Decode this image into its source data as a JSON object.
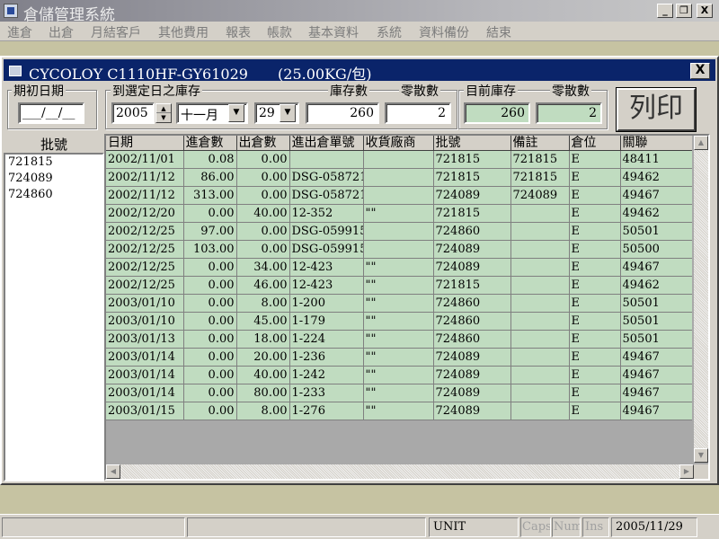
{
  "app": {
    "title": "倉儲管理系統"
  },
  "window_buttons": {
    "minimize": "_",
    "restore": "❐",
    "close": "X"
  },
  "menu": [
    "進倉",
    "出倉",
    "月結客戶",
    "其他費用",
    "報表",
    "帳款",
    "基本資料",
    "系統",
    "資料備份",
    "結束"
  ],
  "child": {
    "title": "CYCOLOY C1110HF-GY61029",
    "weight": "(25.00KG/包)",
    "close": "X"
  },
  "form": {
    "opening_date_label": "期初日期",
    "opening_date_value": "___/__/__",
    "stock_to_date_label": "到選定日之庫存",
    "year": "2005",
    "month": "十一月",
    "day": "29",
    "stock_qty_label": "庫存數",
    "stock_qty_value": "260",
    "loose_qty_label": "零散數",
    "loose_qty_value": "2",
    "current_stock_label": "目前庫存",
    "current_stock_value": "260",
    "current_loose_label": "零散數",
    "current_loose_value": "2",
    "print_label": "列印"
  },
  "batch_list": {
    "header": "批號",
    "items": [
      "721815",
      "724089",
      "724860"
    ]
  },
  "grid": {
    "columns": [
      "日期",
      "進倉數",
      "出倉數",
      "進出倉單號",
      "收貨廠商",
      "批號",
      "備註",
      "倉位",
      "關聯"
    ],
    "rows": [
      [
        "2002/11/01",
        "0.08",
        "0.00",
        "",
        "",
        "721815",
        "721815",
        "E",
        "48411"
      ],
      [
        "2002/11/12",
        "86.00",
        "0.00",
        "DSG-058721",
        "",
        "721815",
        "721815",
        "E",
        "49462"
      ],
      [
        "2002/11/12",
        "313.00",
        "0.00",
        "DSG-058721",
        "",
        "724089",
        "724089",
        "E",
        "49467"
      ],
      [
        "2002/12/20",
        "0.00",
        "40.00",
        "12-352",
        "\"\"",
        "721815",
        "",
        "E",
        "49462"
      ],
      [
        "2002/12/25",
        "97.00",
        "0.00",
        "DSG-059915",
        "",
        "724860",
        "",
        "E",
        "50501"
      ],
      [
        "2002/12/25",
        "103.00",
        "0.00",
        "DSG-059915",
        "",
        "724089",
        "",
        "E",
        "50500"
      ],
      [
        "2002/12/25",
        "0.00",
        "34.00",
        "12-423",
        "\"\"",
        "724089",
        "",
        "E",
        "49467"
      ],
      [
        "2002/12/25",
        "0.00",
        "46.00",
        "12-423",
        "\"\"",
        "721815",
        "",
        "E",
        "49462"
      ],
      [
        "2003/01/10",
        "0.00",
        "8.00",
        "1-200",
        "\"\"",
        "724860",
        "",
        "E",
        "50501"
      ],
      [
        "2003/01/10",
        "0.00",
        "45.00",
        "1-179",
        "\"\"",
        "724860",
        "",
        "E",
        "50501"
      ],
      [
        "2003/01/13",
        "0.00",
        "18.00",
        "1-224",
        "\"\"",
        "724860",
        "",
        "E",
        "50501"
      ],
      [
        "2003/01/14",
        "0.00",
        "20.00",
        "1-236",
        "\"\"",
        "724089",
        "",
        "E",
        "49467"
      ],
      [
        "2003/01/14",
        "0.00",
        "40.00",
        "1-242",
        "\"\"",
        "724089",
        "",
        "E",
        "49467"
      ],
      [
        "2003/01/14",
        "0.00",
        "80.00",
        "1-233",
        "\"\"",
        "724089",
        "",
        "E",
        "49467"
      ],
      [
        "2003/01/15",
        "0.00",
        "8.00",
        "1-276",
        "\"\"",
        "724089",
        "",
        "E",
        "49467"
      ]
    ]
  },
  "status": {
    "unit": "UNIT",
    "caps": "Caps",
    "num": "Num",
    "ins": "Ins",
    "date": "2005/11/29"
  }
}
